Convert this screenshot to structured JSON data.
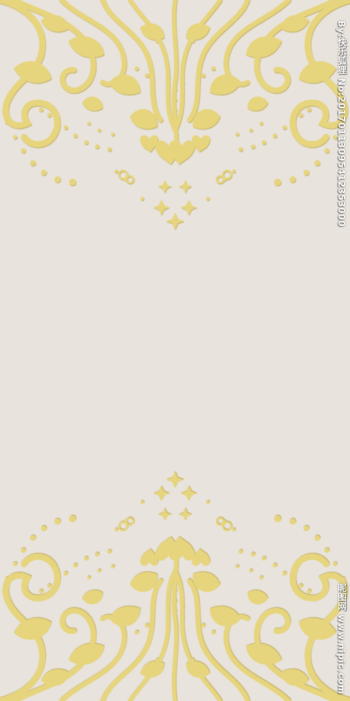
{
  "colors": {
    "background": "#e8e3dc",
    "ornament": "#e6d57c",
    "ornament_highlight": "#f7efbf",
    "ornament_shadow": "#c9b556"
  },
  "ornament": {
    "style": "damask-filigree",
    "top_icon": "damask-ornament-icon",
    "bottom_icon": "damask-ornament-icon"
  },
  "watermark": {
    "top_text": "By:快乐狐狸 No:20170113095412353000",
    "bottom_text": "昵图网 www.nipic.com"
  }
}
